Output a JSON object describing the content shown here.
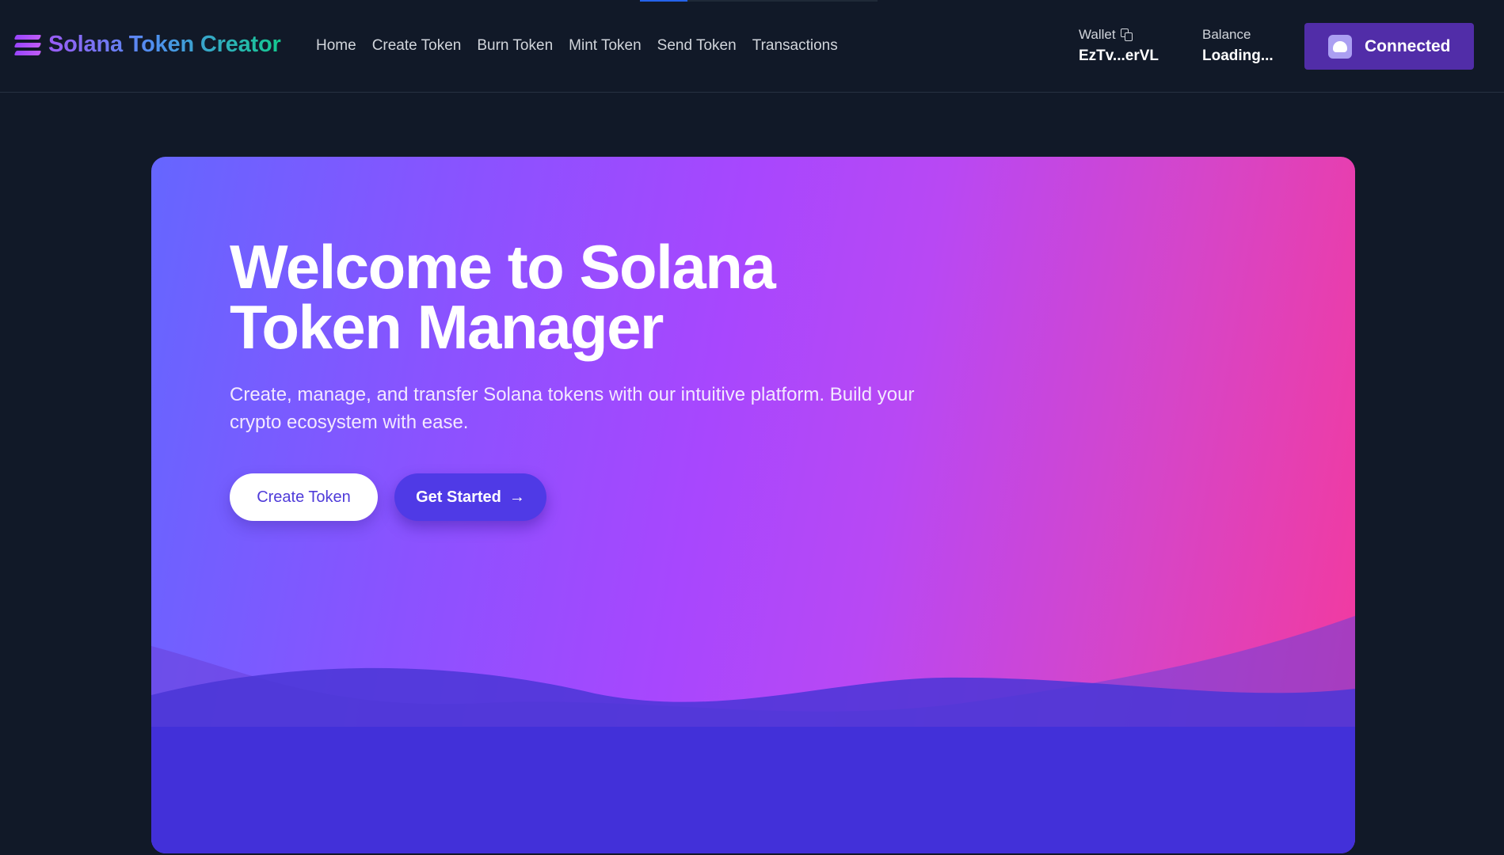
{
  "brand": {
    "name": "Solana Token Creator",
    "icon": "solana-logo-icon"
  },
  "nav": {
    "items": [
      {
        "label": "Home"
      },
      {
        "label": "Create Token"
      },
      {
        "label": "Burn Token"
      },
      {
        "label": "Mint Token"
      },
      {
        "label": "Send Token"
      },
      {
        "label": "Transactions"
      }
    ]
  },
  "wallet": {
    "label": "Wallet",
    "address": "EzTv...erVL",
    "copy_icon": "copy-icon"
  },
  "balance": {
    "label": "Balance",
    "value": "Loading..."
  },
  "connect_button": {
    "label": "Connected",
    "icon": "phantom-wallet-icon",
    "color": "#512da8"
  },
  "hero": {
    "title": "Welcome to Solana Token Manager",
    "subtitle": "Create, manage, and transfer Solana tokens with our intuitive platform. Build your crypto ecosystem with ease.",
    "primary_button": "Create Token",
    "secondary_button": "Get Started",
    "secondary_icon": "arrow-right-icon",
    "gradient_start": "#6566ff",
    "gradient_end": "#f5399b"
  },
  "colors": {
    "background": "#111928",
    "accent": "#4f3ae6"
  }
}
